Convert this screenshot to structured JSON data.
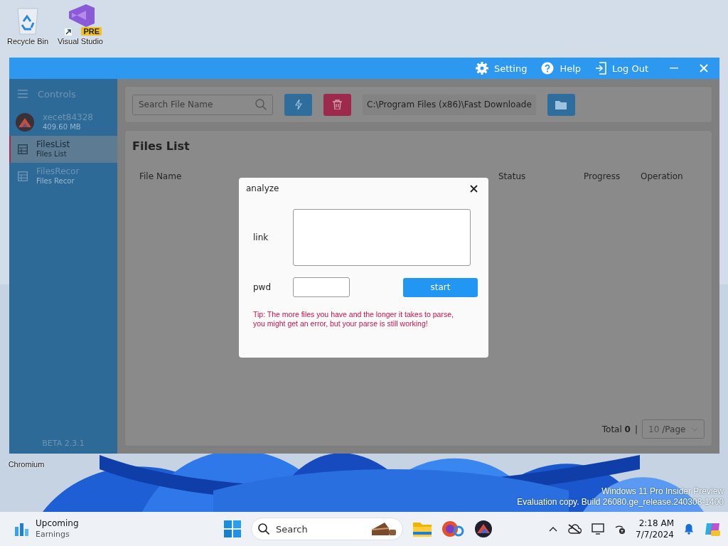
{
  "desktop": {
    "icons": [
      {
        "label": "Recycle Bin",
        "kind": "bin"
      },
      {
        "label": "Visual Studio",
        "kind": "vs",
        "badge": "PRE"
      },
      {
        "label": "Chromium",
        "kind": "hidden"
      }
    ],
    "watermark": [
      "Windows 11 Pro Insider Preview",
      "Evaluation copy. Build 26080.ge_release.240308-1400"
    ]
  },
  "window": {
    "actions": [
      {
        "label": "Setting",
        "kind": "gear"
      },
      {
        "label": "Help",
        "kind": "help"
      },
      {
        "label": "Log Out",
        "kind": "logout"
      }
    ]
  },
  "sidebar": {
    "header": "Controls",
    "user": {
      "name": "xecet84328",
      "size": "409.60 MB"
    },
    "items": [
      {
        "title": "FilesList",
        "subtitle": "Files List",
        "selected": true
      },
      {
        "title": "FilesRecor",
        "subtitle": "Files Recor",
        "selected": false
      }
    ],
    "version": "BETA 2.3.1"
  },
  "toolbar": {
    "search_placeholder": "Search File Name",
    "path": "C:\\Program Files (x86)\\Fast Downloade"
  },
  "files": {
    "title": "Files List",
    "columns": [
      "File Name",
      "Status",
      "Progress",
      "Operation"
    ],
    "total_label": "Total",
    "total": "0",
    "separator": "|",
    "page_size": "10",
    "page_unit": "/Page"
  },
  "dialog": {
    "title": "analyze",
    "link_label": "link",
    "pwd_label": "pwd",
    "button": "start",
    "tip": "Tip: The more files you have and the longer it takes to parse, you might get an error, but your parse is still working!"
  },
  "taskbar": {
    "widget": {
      "title": "Upcoming",
      "subtitle": "Earnings"
    },
    "search_placeholder": "Search",
    "time": "2:18 AM",
    "date": "7/7/2024"
  }
}
